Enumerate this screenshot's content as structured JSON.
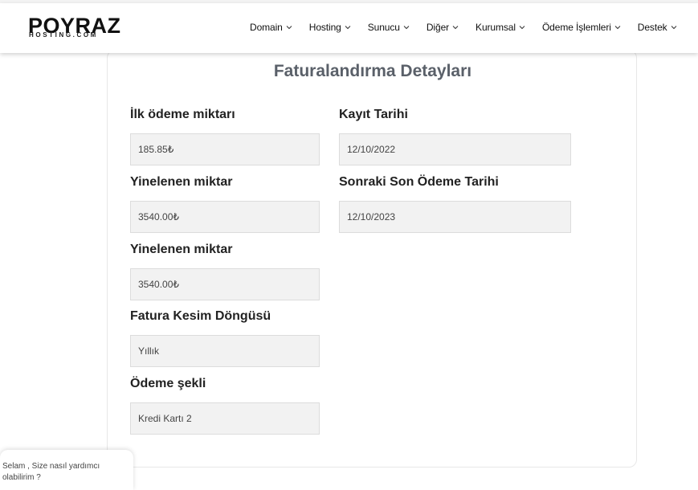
{
  "brand": {
    "name": "POYRAZ",
    "sub": "HOSTING.COM"
  },
  "nav": {
    "items": [
      {
        "label": "Domain"
      },
      {
        "label": "Hosting"
      },
      {
        "label": "Sunucu"
      },
      {
        "label": "Diğer"
      },
      {
        "label": "Kurumsal"
      },
      {
        "label": "Ödeme İşlemleri"
      },
      {
        "label": "Destek"
      }
    ]
  },
  "card": {
    "title": "Faturalandırma Detayları",
    "left": [
      {
        "label": "İlk ödeme miktarı",
        "value": "185.85₺"
      },
      {
        "label": "Yinelenen miktar",
        "value": "3540.00₺"
      },
      {
        "label": "Yinelenen miktar",
        "value": "3540.00₺"
      },
      {
        "label": "Fatura Kesim Döngüsü",
        "value": "Yıllık"
      },
      {
        "label": "Ödeme şekli",
        "value": "Kredi Kartı 2"
      }
    ],
    "right": [
      {
        "label": "Kayıt Tarihi",
        "value": "12/10/2022"
      },
      {
        "label": "Sonraki Son Ödeme Tarihi",
        "value": "12/10/2023"
      }
    ]
  },
  "chat": {
    "message": "Selam , Size nasıl yardımcı olabilirim ?"
  },
  "colors": {
    "title": "#5a6069",
    "field_bg": "#f2f2f2",
    "field_border": "#dcdcdc"
  },
  "icons": {
    "nav_chevron": "chevron-down-icon"
  }
}
